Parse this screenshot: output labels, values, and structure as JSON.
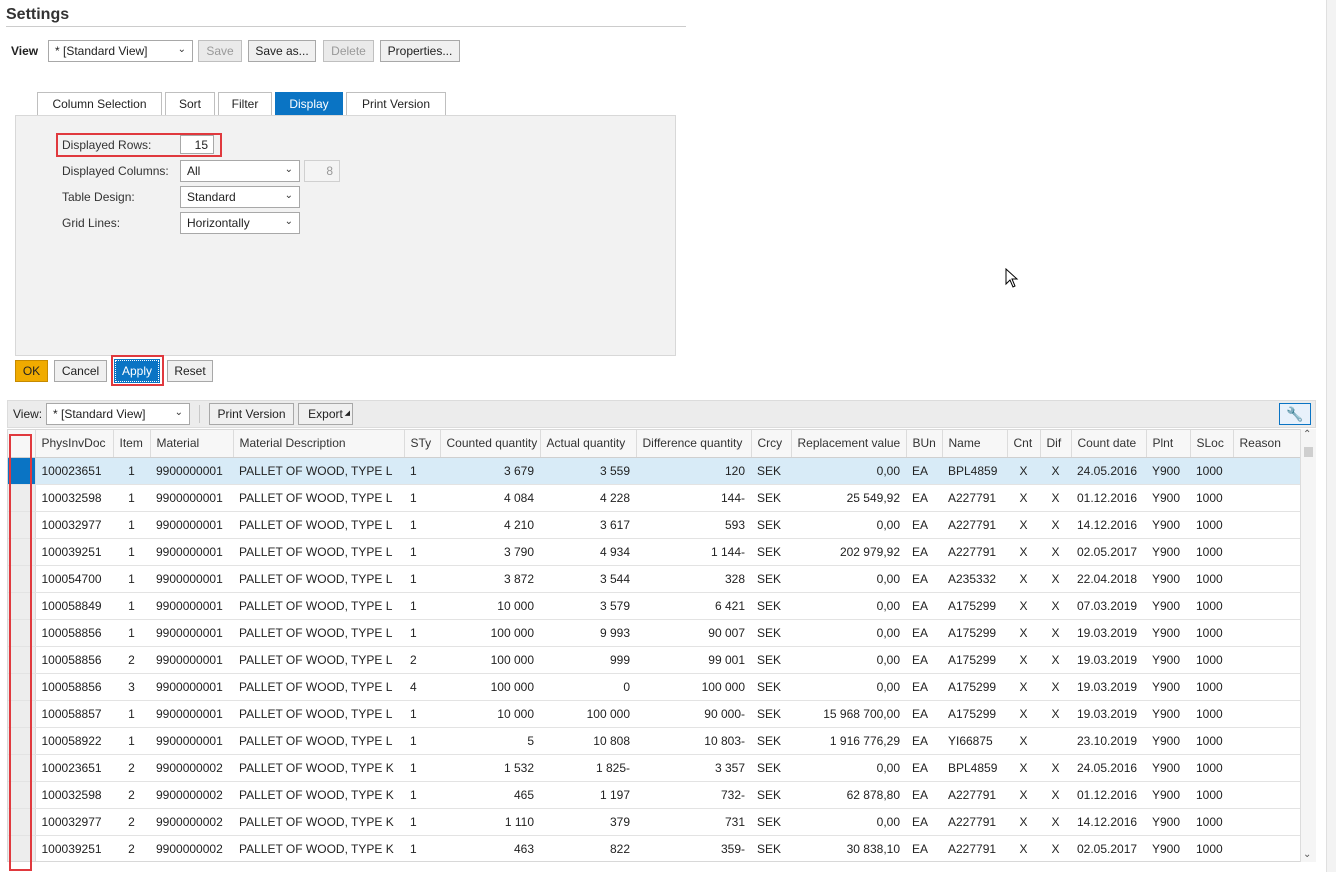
{
  "settings": {
    "title": "Settings",
    "view_label": "View",
    "view_value": "* [Standard View]",
    "save_label": "Save",
    "save_as_label": "Save as...",
    "delete_label": "Delete",
    "properties_label": "Properties..."
  },
  "tabs": [
    {
      "label": "Column Selection",
      "active": false
    },
    {
      "label": "Sort",
      "active": false
    },
    {
      "label": "Filter",
      "active": false
    },
    {
      "label": "Display",
      "active": true
    },
    {
      "label": "Print Version",
      "active": false
    }
  ],
  "display": {
    "rows_label": "Displayed Rows:",
    "rows_value": "15",
    "columns_label": "Displayed Columns:",
    "columns_value": "All",
    "columns_count": "8",
    "design_label": "Table Design:",
    "design_value": "Standard",
    "gridlines_label": "Grid Lines:",
    "gridlines_value": "Horizontally"
  },
  "actions": {
    "ok": "OK",
    "cancel": "Cancel",
    "apply": "Apply",
    "reset": "Reset"
  },
  "table_toolbar": {
    "view_label": "View:",
    "view_value": "* [Standard View]",
    "print_label": "Print Version",
    "export_label": "Export"
  },
  "table": {
    "columns": [
      "PhysInvDoc",
      "Item",
      "Material",
      "Material Description",
      "STy",
      "Counted quantity",
      "Actual quantity",
      "Difference quantity",
      "Crcy",
      "Replacement value",
      "BUn",
      "Name",
      "Cnt",
      "Dif",
      "Count date",
      "Plnt",
      "SLoc",
      "Reason"
    ],
    "rows": [
      [
        "100023651",
        "1",
        "9900000001",
        "PALLET OF WOOD, TYPE L",
        "1",
        "3 679",
        "3 559",
        "120",
        "SEK",
        "0,00",
        "EA",
        "BPL4859",
        "X",
        "X",
        "24.05.2016",
        "Y900",
        "1000",
        ""
      ],
      [
        "100032598",
        "1",
        "9900000001",
        "PALLET OF WOOD, TYPE L",
        "1",
        "4 084",
        "4 228",
        "144-",
        "SEK",
        "25 549,92",
        "EA",
        "A227791",
        "X",
        "X",
        "01.12.2016",
        "Y900",
        "1000",
        ""
      ],
      [
        "100032977",
        "1",
        "9900000001",
        "PALLET OF WOOD, TYPE L",
        "1",
        "4 210",
        "3 617",
        "593",
        "SEK",
        "0,00",
        "EA",
        "A227791",
        "X",
        "X",
        "14.12.2016",
        "Y900",
        "1000",
        ""
      ],
      [
        "100039251",
        "1",
        "9900000001",
        "PALLET OF WOOD, TYPE L",
        "1",
        "3 790",
        "4 934",
        "1 144-",
        "SEK",
        "202 979,92",
        "EA",
        "A227791",
        "X",
        "X",
        "02.05.2017",
        "Y900",
        "1000",
        ""
      ],
      [
        "100054700",
        "1",
        "9900000001",
        "PALLET OF WOOD, TYPE L",
        "1",
        "3 872",
        "3 544",
        "328",
        "SEK",
        "0,00",
        "EA",
        "A235332",
        "X",
        "X",
        "22.04.2018",
        "Y900",
        "1000",
        ""
      ],
      [
        "100058849",
        "1",
        "9900000001",
        "PALLET OF WOOD, TYPE L",
        "1",
        "10 000",
        "3 579",
        "6 421",
        "SEK",
        "0,00",
        "EA",
        "A175299",
        "X",
        "X",
        "07.03.2019",
        "Y900",
        "1000",
        ""
      ],
      [
        "100058856",
        "1",
        "9900000001",
        "PALLET OF WOOD, TYPE L",
        "1",
        "100 000",
        "9 993",
        "90 007",
        "SEK",
        "0,00",
        "EA",
        "A175299",
        "X",
        "X",
        "19.03.2019",
        "Y900",
        "1000",
        ""
      ],
      [
        "100058856",
        "2",
        "9900000001",
        "PALLET OF WOOD, TYPE L",
        "2",
        "100 000",
        "999",
        "99 001",
        "SEK",
        "0,00",
        "EA",
        "A175299",
        "X",
        "X",
        "19.03.2019",
        "Y900",
        "1000",
        ""
      ],
      [
        "100058856",
        "3",
        "9900000001",
        "PALLET OF WOOD, TYPE L",
        "4",
        "100 000",
        "0",
        "100 000",
        "SEK",
        "0,00",
        "EA",
        "A175299",
        "X",
        "X",
        "19.03.2019",
        "Y900",
        "1000",
        ""
      ],
      [
        "100058857",
        "1",
        "9900000001",
        "PALLET OF WOOD, TYPE L",
        "1",
        "10 000",
        "100 000",
        "90 000-",
        "SEK",
        "15 968 700,00",
        "EA",
        "A175299",
        "X",
        "X",
        "19.03.2019",
        "Y900",
        "1000",
        ""
      ],
      [
        "100058922",
        "1",
        "9900000001",
        "PALLET OF WOOD, TYPE L",
        "1",
        "5",
        "10 808",
        "10 803-",
        "SEK",
        "1 916 776,29",
        "EA",
        "YI66875",
        "X",
        "",
        "23.10.2019",
        "Y900",
        "1000",
        ""
      ],
      [
        "100023651",
        "2",
        "9900000002",
        "PALLET OF WOOD, TYPE K",
        "1",
        "1 532",
        "1 825-",
        "3 357",
        "SEK",
        "0,00",
        "EA",
        "BPL4859",
        "X",
        "X",
        "24.05.2016",
        "Y900",
        "1000",
        ""
      ],
      [
        "100032598",
        "2",
        "9900000002",
        "PALLET OF WOOD, TYPE K",
        "1",
        "465",
        "1 197",
        "732-",
        "SEK",
        "62 878,80",
        "EA",
        "A227791",
        "X",
        "X",
        "01.12.2016",
        "Y900",
        "1000",
        ""
      ],
      [
        "100032977",
        "2",
        "9900000002",
        "PALLET OF WOOD, TYPE K",
        "1",
        "1 110",
        "379",
        "731",
        "SEK",
        "0,00",
        "EA",
        "A227791",
        "X",
        "X",
        "14.12.2016",
        "Y900",
        "1000",
        ""
      ],
      [
        "100039251",
        "2",
        "9900000002",
        "PALLET OF WOOD, TYPE K",
        "1",
        "463",
        "822",
        "359-",
        "SEK",
        "30 838,10",
        "EA",
        "A227791",
        "X",
        "X",
        "02.05.2017",
        "Y900",
        "1000",
        ""
      ]
    ]
  },
  "icons": {
    "settings_icon": "wrench-icon",
    "dropdown_icon": "chevron-down-icon",
    "scroll_up_icon": "chevron-up-icon",
    "scroll_down_icon": "chevron-down-icon"
  },
  "colors": {
    "accent": "#0a74c4",
    "ok_button": "#f0ab00",
    "highlight": "#e0393e",
    "selected_row": "#d8ebf7"
  }
}
